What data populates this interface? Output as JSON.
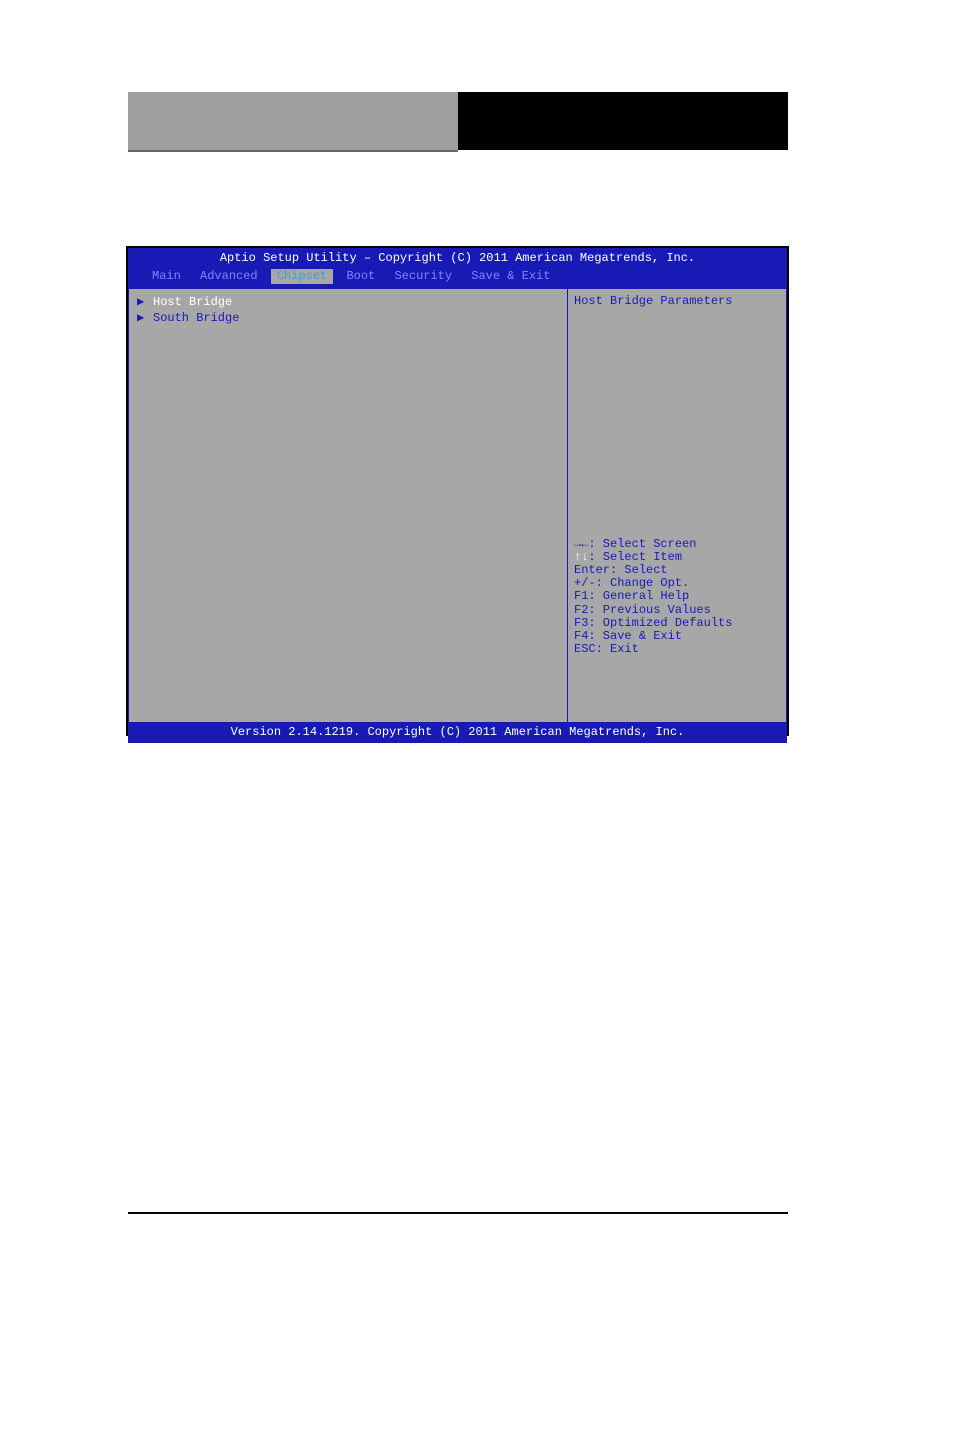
{
  "header": {
    "title": "Aptio Setup Utility – Copyright (C) 2011 American Megatrends, Inc."
  },
  "tabs": {
    "items": [
      {
        "label": "Main",
        "active": false
      },
      {
        "label": "Advanced",
        "active": false
      },
      {
        "label": "Chipset",
        "active": true
      },
      {
        "label": "Boot",
        "active": false
      },
      {
        "label": "Security",
        "active": false
      },
      {
        "label": "Save & Exit",
        "active": false
      }
    ]
  },
  "menu": {
    "items": [
      {
        "label": "Host Bridge",
        "selected": true
      },
      {
        "label": "South Bridge",
        "selected": false
      }
    ]
  },
  "help": {
    "description": "Host Bridge Parameters",
    "keys": [
      {
        "symbol": "→←",
        "text": ": Select Screen",
        "highlight": false
      },
      {
        "symbol": "↑↓",
        "text": ": Select Item",
        "highlight": true
      },
      {
        "symbol": "Enter",
        "text": ": Select",
        "highlight": false
      },
      {
        "symbol": "+/-",
        "text": ": Change Opt.",
        "highlight": false
      },
      {
        "symbol": "F1",
        "text": ": General Help",
        "highlight": false
      },
      {
        "symbol": "F2",
        "text": ": Previous Values",
        "highlight": false
      },
      {
        "symbol": "F3",
        "text": ": Optimized Defaults",
        "highlight": false
      },
      {
        "symbol": "F4",
        "text": ": Save & Exit",
        "highlight": false
      },
      {
        "symbol": "ESC",
        "text": ": Exit",
        "highlight": false
      }
    ]
  },
  "footer": {
    "text": "Version 2.14.1219. Copyright (C) 2011 American Megatrends, Inc."
  }
}
